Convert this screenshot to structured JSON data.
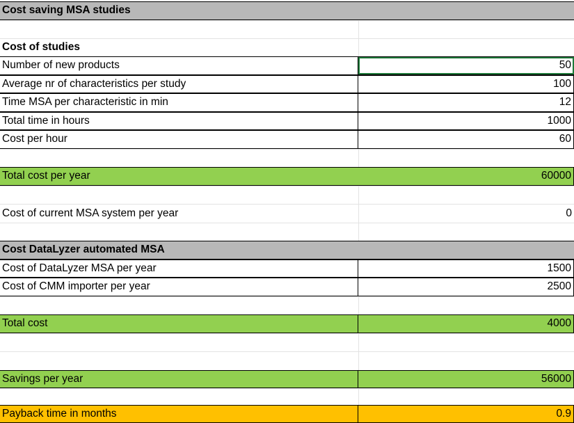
{
  "title": "Cost saving MSA studies",
  "cost_of_studies": {
    "heading": "Cost of studies",
    "rows": [
      {
        "label": "Number of new products",
        "value": "50"
      },
      {
        "label": "Average nr of characteristics per study",
        "value": "100"
      },
      {
        "label": "Time MSA per characteristic in min",
        "value": "12"
      },
      {
        "label": "Total time in hours",
        "value": "1000"
      },
      {
        "label": "Cost per hour",
        "value": "60"
      }
    ]
  },
  "total_cost_per_year": {
    "label": "Total cost per year",
    "value": "60000"
  },
  "current_msa": {
    "label": "Cost of current MSA system per year",
    "value": "0"
  },
  "datalyzer": {
    "heading": "Cost DataLyzer automated MSA",
    "rows": [
      {
        "label": "Cost of DataLyzer MSA per year",
        "value": "1500"
      },
      {
        "label": "Cost of CMM importer per year",
        "value": "2500"
      }
    ]
  },
  "total_cost": {
    "label": "Total cost",
    "value": "4000"
  },
  "savings": {
    "label": "Savings per year",
    "value": "56000"
  },
  "payback": {
    "label": "Payback time in months",
    "value": "0.9"
  },
  "colors": {
    "header_gray": "#b8b8b8",
    "total_green": "#92d050",
    "payback_orange": "#ffc000",
    "selection_green": "#1f7a3a"
  }
}
